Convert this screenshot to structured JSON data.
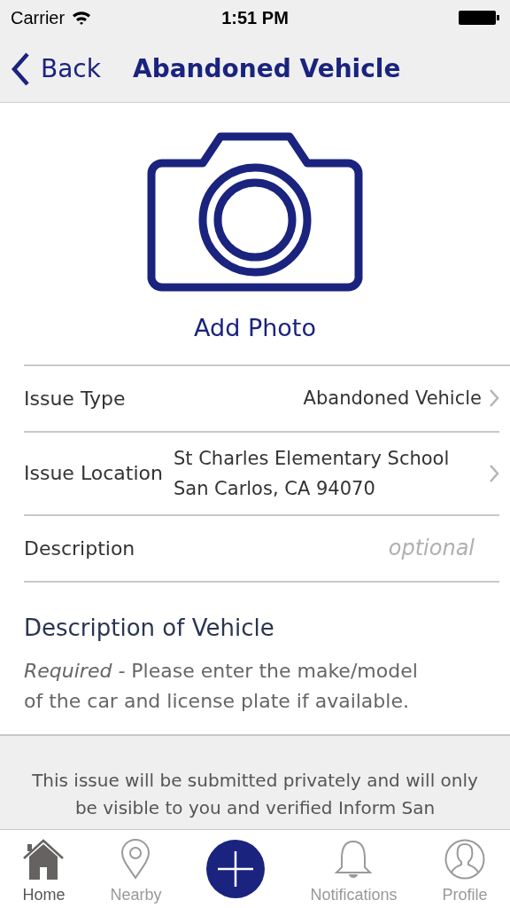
{
  "status_bar": {
    "carrier": "Carrier",
    "time": "1:51 PM"
  },
  "nav": {
    "back": "Back",
    "title": "Abandoned Vehicle"
  },
  "photo": {
    "label": "Add Photo"
  },
  "rows": [
    {
      "kind": "select",
      "label": "Issue Type",
      "lines": [
        "Abandoned Vehicle"
      ]
    },
    {
      "kind": "select",
      "label": "Issue Location",
      "lines": [
        "St Charles Elementary School",
        "San Carlos, CA 94070"
      ]
    },
    {
      "kind": "input",
      "label": "Description",
      "placeholder": "optional"
    }
  ],
  "vehicle": {
    "title": "Description of Vehicle",
    "hint": "*Required -* Please enter the make/model of the car and license plate if available."
  },
  "notice": "This issue will be submitted privately and will only be visible to you and verified Inform San",
  "tabs": [
    {
      "label": "Home",
      "kind": "home",
      "selected": true
    },
    {
      "label": "Nearby",
      "kind": "pin",
      "selected": false
    },
    {
      "kind": "add"
    },
    {
      "label": "Notifications",
      "kind": "bell",
      "selected": false
    },
    {
      "label": "Profile",
      "kind": "person",
      "selected": false
    }
  ]
}
